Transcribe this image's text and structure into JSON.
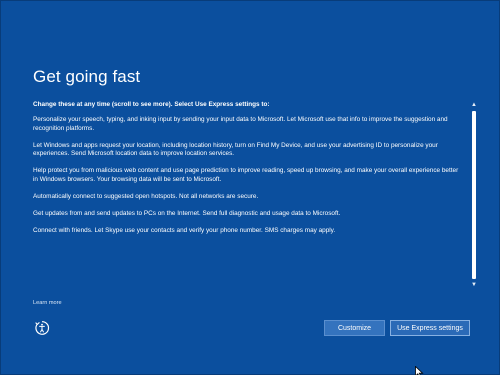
{
  "page": {
    "title": "Get going fast"
  },
  "content": {
    "intro": "Change these at any time (scroll to see more). Select Use Express settings to:",
    "paragraphs": [
      "Personalize your speech, typing, and inking input by sending your input data to Microsoft. Let Microsoft use that info to improve the suggestion and recognition platforms.",
      "Let Windows and apps request your location, including location history, turn on Find My Device, and use your advertising ID to personalize your experiences. Send Microsoft location data to improve location services.",
      "Help protect you from malicious web content and use page prediction to improve reading, speed up browsing, and make your overall experience better in Windows browsers. Your browsing data will be sent to Microsoft.",
      "Automatically connect to suggested open hotspots. Not all networks are secure.",
      "Get updates from and send updates to PCs on the Internet. Send full diagnostic and usage data to Microsoft.",
      "Connect with friends. Let Skype use your contacts and verify your phone number. SMS charges may apply."
    ]
  },
  "footer": {
    "learn_more": "Learn more",
    "customize_label": "Customize",
    "express_label": "Use Express settings"
  },
  "icons": {
    "ease_of_access": "ease-of-access-icon",
    "scroll_up": "chevron-up-icon",
    "scroll_down": "chevron-down-icon",
    "cursor": "mouse-pointer-icon"
  },
  "colors": {
    "background": "#0b4f9e",
    "button_customize": "#3473be",
    "button_express": "#2b6ab7",
    "text": "#ffffff"
  }
}
